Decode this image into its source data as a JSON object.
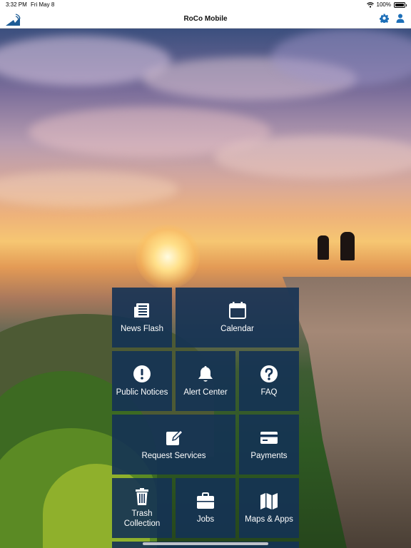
{
  "status": {
    "time": "3:32 PM",
    "date": "Fri May 8",
    "battery": "100%"
  },
  "nav": {
    "title": "RoCo Mobile"
  },
  "tiles": {
    "news_flash": "News Flash",
    "calendar": "Calendar",
    "public_notices": "Public Notices",
    "alert_center": "Alert Center",
    "faq": "FAQ",
    "request_services": "Request Services",
    "payments": "Payments",
    "trash_line1": "Trash",
    "trash_line2": "Collection",
    "jobs": "Jobs",
    "maps_apps": "Maps & Apps"
  },
  "icons": [
    "signal-logo-icon",
    "wifi-icon",
    "battery-icon",
    "gear-icon",
    "person-icon",
    "newspaper-icon",
    "calendar-icon",
    "exclamation-icon",
    "bell-icon",
    "question-icon",
    "pencil-icon",
    "credit-card-icon",
    "trash-icon",
    "briefcase-icon",
    "map-icon"
  ]
}
